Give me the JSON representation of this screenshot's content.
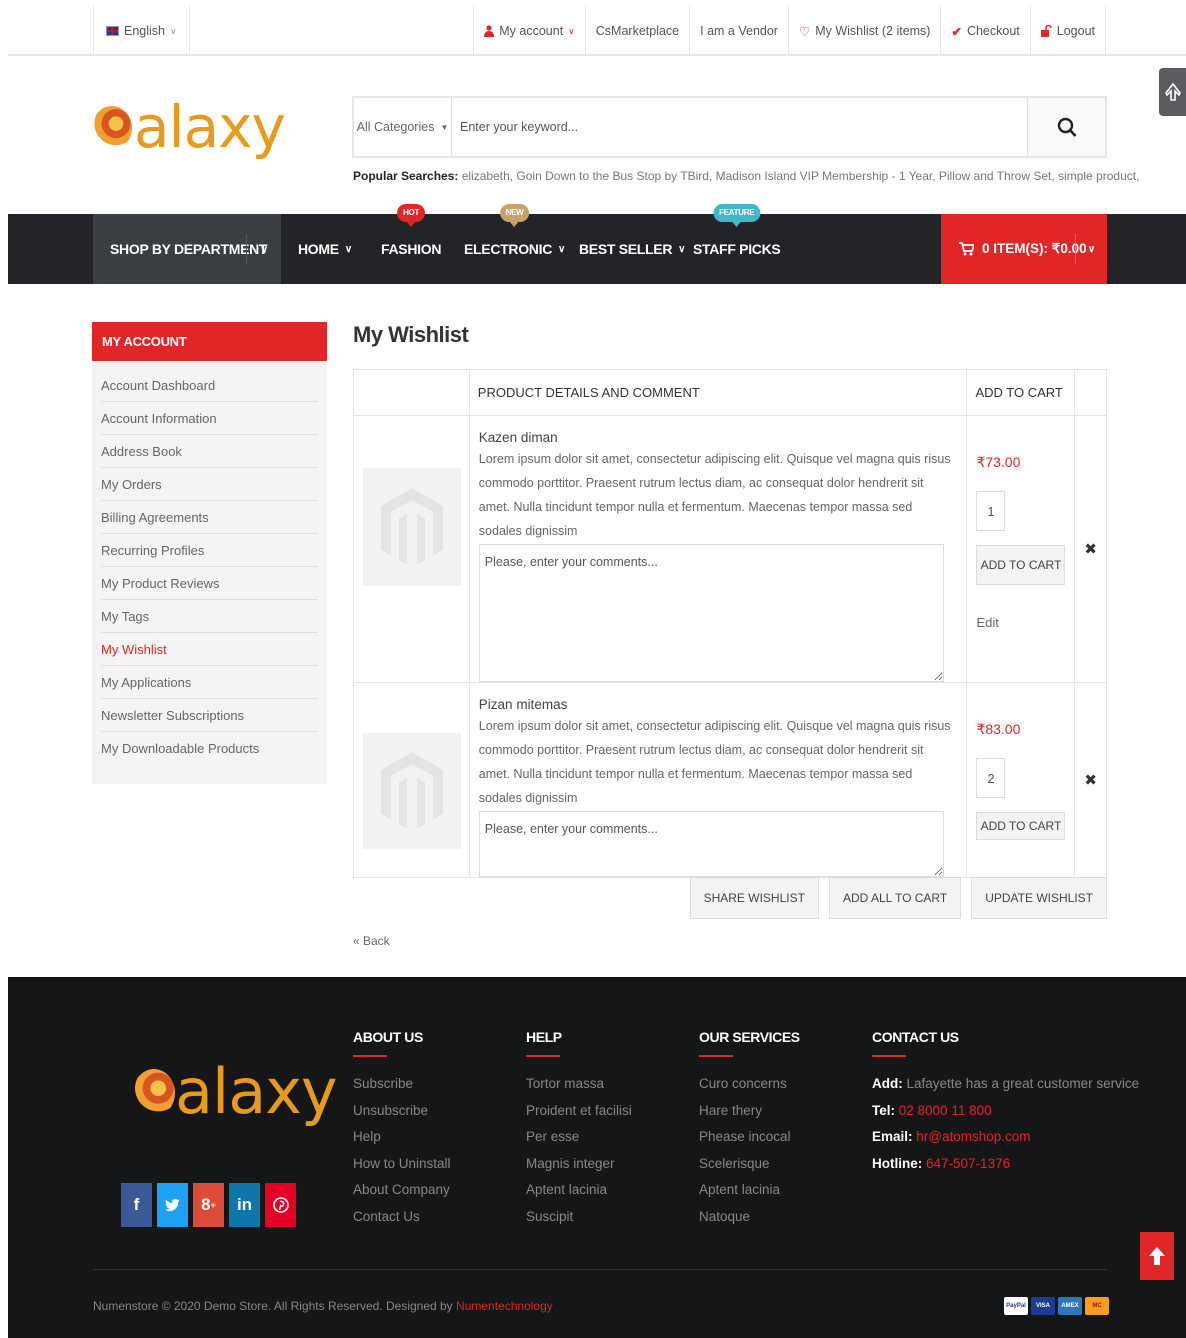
{
  "topbar": {
    "language": "English",
    "links": [
      {
        "label": "My account",
        "icon": "user-icon",
        "dropdown": true
      },
      {
        "label": "CsMarketplace"
      },
      {
        "label": "I am a Vendor"
      },
      {
        "label": "My Wishlist (2 items)",
        "icon": "heart-icon"
      },
      {
        "label": "Checkout",
        "icon": "check-icon"
      },
      {
        "label": "Logout",
        "icon": "lock-icon"
      }
    ]
  },
  "header": {
    "logo_text": "alaxy",
    "search": {
      "category": "All Categories",
      "placeholder": "Enter your keyword..."
    },
    "popular_label": "Popular Searches:",
    "popular_terms": "elizabeth, Goin Down to the Bus Stop by TBird, Madison Island VIP Membership - 1 Year, Pillow and Throw Set, simple product,"
  },
  "nav": {
    "department": "SHOP BY DEPARTMENT",
    "items": [
      {
        "label": "HOME",
        "dropdown": true
      },
      {
        "label": "FASHION",
        "badge": "HOT",
        "badge_color": "#e02626"
      },
      {
        "label": "ELECTRONIC",
        "dropdown": true,
        "badge": "NEW",
        "badge_color": "#c9a26b"
      },
      {
        "label": "BEST SELLER",
        "dropdown": true
      },
      {
        "label": "STAFF PICKS",
        "badge": "FEATURE",
        "badge_color": "#3fb9c9"
      }
    ],
    "cart": "0 ITEM(S): ₹0.00"
  },
  "sidebar": {
    "title": "MY ACCOUNT",
    "items": [
      "Account Dashboard",
      "Account Information",
      "Address Book",
      "My Orders",
      "Billing Agreements",
      "Recurring Profiles",
      "My Product Reviews",
      "My Tags",
      "My Wishlist",
      "My Applications",
      "Newsletter Subscriptions",
      "My Downloadable Products"
    ],
    "active": "My Wishlist"
  },
  "main": {
    "title": "My Wishlist",
    "columns": {
      "details": "PRODUCT DETAILS AND COMMENT",
      "cart": "ADD TO CART"
    },
    "comment_placeholder": "Please, enter your comments...",
    "add_to_cart": "ADD TO CART",
    "edit": "Edit",
    "rows": [
      {
        "name": "Kazen diman",
        "description": "Lorem ipsum dolor sit amet, consectetur adipiscing elit. Quisque vel magna quis risus commodo porttitor. Praesent rutrum lectus diam, ac consequat dolor hendrerit sit amet. Nulla tincidunt tempor nulla et fermentum. Maecenas tempor massa sed sodales dignissim",
        "price": "₹73.00",
        "qty": "1"
      },
      {
        "name": "Pizan mitemas",
        "description": "Lorem ipsum dolor sit amet, consectetur adipiscing elit. Quisque vel magna quis risus commodo porttitor. Praesent rutrum lectus diam, ac consequat dolor hendrerit sit amet. Nulla tincidunt tempor nulla et fermentum. Maecenas tempor massa sed sodales dignissim",
        "price": "₹83.00",
        "qty": "2"
      }
    ],
    "buttons": {
      "share": "SHARE WISHLIST",
      "add_all": "ADD ALL TO CART",
      "update": "UPDATE WISHLIST"
    },
    "back": "« Back"
  },
  "footer": {
    "logo_text": "alaxy",
    "about": {
      "title": "ABOUT US",
      "links": [
        "Subscribe",
        "Unsubscribe",
        "Help",
        "How to Uninstall",
        "About Company",
        "Contact Us"
      ]
    },
    "help": {
      "title": "HELP",
      "links": [
        "Tortor massa",
        "Proident et facilisi",
        "Per esse",
        "Magnis integer",
        "Aptent lacinia",
        "Suscipit"
      ]
    },
    "services": {
      "title": "OUR SERVICES",
      "links": [
        "Curo concerns",
        "Hare thery",
        "Phease incocal",
        "Scelerisque",
        "Aptent lacinia",
        "Natoque"
      ]
    },
    "contact": {
      "title": "CONTACT US",
      "add_label": "Add:",
      "add": "Lafayette has a great customer service",
      "tel_label": "Tel:",
      "tel": "02 8000 11 800",
      "email_label": "Email:",
      "email": "hr@atomshop.com",
      "hotline_label": "Hotline:",
      "hotline": "647-507-1376"
    },
    "copyright": "Numenstore © 2020 Demo Store. All Rights Reserved. Designed by",
    "designer": "Numentechnology",
    "payments": [
      "PayPal",
      "VISA",
      "AMEX",
      "MC"
    ]
  },
  "colors": {
    "accent": "#e02626",
    "nav_bg": "#222427",
    "footer_bg": "#151618",
    "logo": "#e79a1d"
  }
}
